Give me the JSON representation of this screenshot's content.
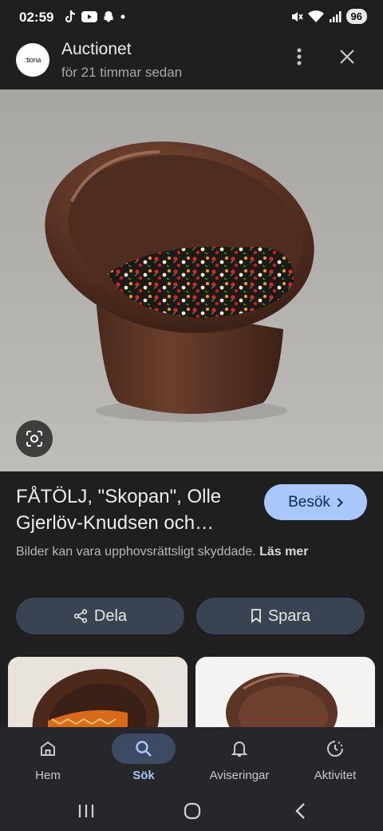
{
  "status_bar": {
    "time": "02:59",
    "battery": "96",
    "left_icons": [
      "tiktok-icon",
      "youtube-icon",
      "snapchat-icon",
      "dot-icon"
    ],
    "right_icons": [
      "mute-icon",
      "wifi-icon",
      "signal-icon"
    ]
  },
  "header": {
    "logo_text": ":tiona",
    "title": "Auctionet",
    "subtitle": "för 21 timmar sedan"
  },
  "item": {
    "title": "FÅTÖLJ, \"Skopan\", Olle Gjerlöv-Knudsen och…",
    "visit_label": "Besök",
    "copyright_text": "Bilder kan vara upphovsrättsligt skyddade.",
    "read_more": "Läs mer",
    "share_label": "Dela",
    "save_label": "Spara"
  },
  "bottom_nav": {
    "items": [
      {
        "label": "Hem",
        "icon": "home-icon",
        "active": false
      },
      {
        "label": "Sök",
        "icon": "search-icon",
        "active": true
      },
      {
        "label": "Aviseringar",
        "icon": "bell-icon",
        "active": false
      },
      {
        "label": "Aktivitet",
        "icon": "activity-icon",
        "active": false
      }
    ]
  },
  "colors": {
    "background": "#1f1f1f",
    "accent": "#a8c7fa",
    "chair_brown": "#5a3526"
  }
}
